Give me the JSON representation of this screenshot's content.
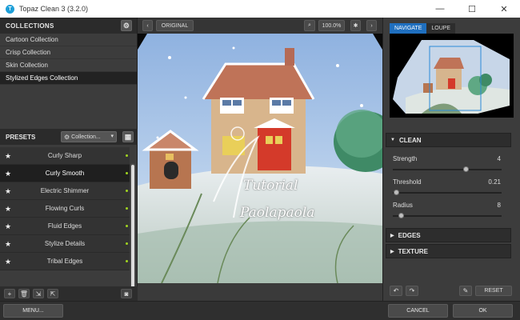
{
  "window": {
    "title": "Topaz Clean 3 (3.2.0)",
    "minimize_glyph": "—",
    "maximize_glyph": "☐",
    "close_glyph": "✕"
  },
  "collections": {
    "header": "COLLECTIONS",
    "items": [
      {
        "label": "Cartoon Collection"
      },
      {
        "label": "Crisp Collection"
      },
      {
        "label": "Skin Collection"
      },
      {
        "label": "Stylized Edges Collection"
      }
    ],
    "selected_index": 3
  },
  "presets": {
    "header": "PRESETS",
    "dropdown_label": "Collection...",
    "items": [
      {
        "label": "Curly Sharp"
      },
      {
        "label": "Curly Smooth"
      },
      {
        "label": "Electric Shimmer"
      },
      {
        "label": "Flowing Curls"
      },
      {
        "label": "Fluid Edges"
      },
      {
        "label": "Stylize Details"
      },
      {
        "label": "Tribal Edges"
      }
    ],
    "selected_index": 1
  },
  "toolbar": {
    "original_label": "ORIGINAL",
    "zoom": "100.0%"
  },
  "preview": {
    "watermark_line1": "Tutorial",
    "watermark_line2": "Paolapaola"
  },
  "navigator": {
    "tabs": [
      "NAVIGATE",
      "LOUPE"
    ],
    "active_tab": 0
  },
  "clean": {
    "header": "CLEAN",
    "sliders": [
      {
        "label": "Strength",
        "value": "4",
        "fraction": 0.67
      },
      {
        "label": "Threshold",
        "value": "0.21",
        "fraction": 0.03
      },
      {
        "label": "Radius",
        "value": "8",
        "fraction": 0.07
      }
    ]
  },
  "sections": {
    "edges": "EDGES",
    "texture": "TEXTURE"
  },
  "footer": {
    "reset": "RESET",
    "menu": "MENU...",
    "cancel": "CANCEL",
    "ok": "OK"
  },
  "colors": {
    "accent": "#1f6fbf",
    "preset_dot": "#9fd420"
  }
}
